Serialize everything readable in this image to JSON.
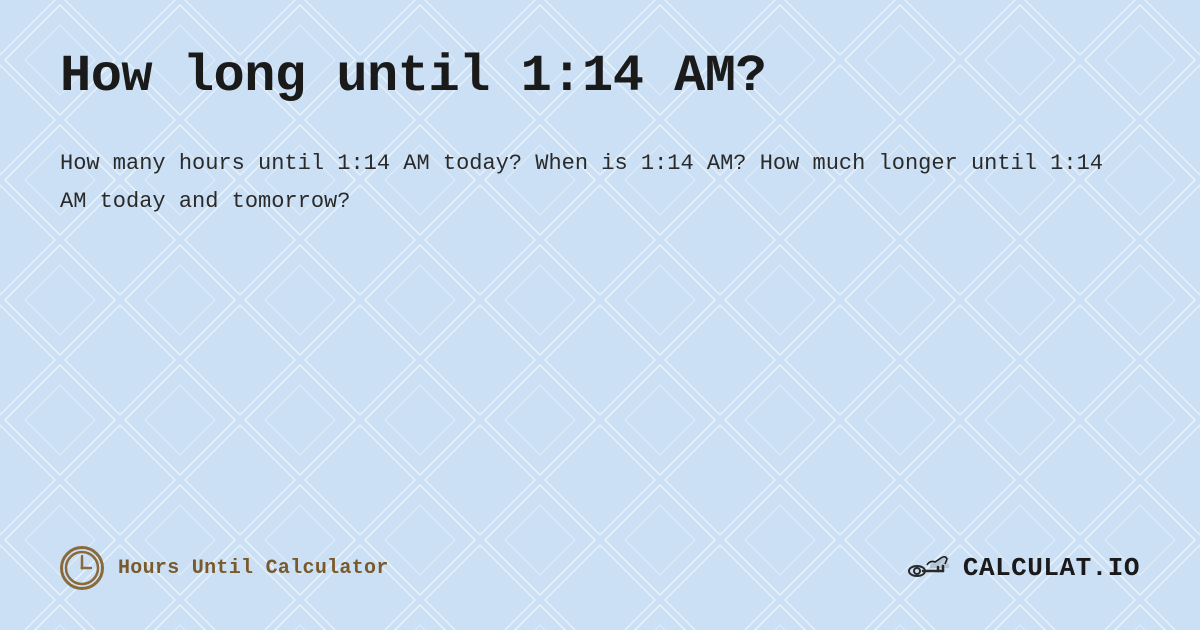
{
  "page": {
    "title": "How long until 1:14 AM?",
    "description": "How many hours until 1:14 AM today? When is 1:14 AM? How much longer until 1:14 AM today and tomorrow?",
    "background_color": "#cce0f5"
  },
  "footer": {
    "left_brand_label": "Hours Until Calculator",
    "right_brand_label": "CALCULAT.IO",
    "clock_icon_name": "clock-icon",
    "hand_icon_name": "pointing-hand-icon"
  }
}
